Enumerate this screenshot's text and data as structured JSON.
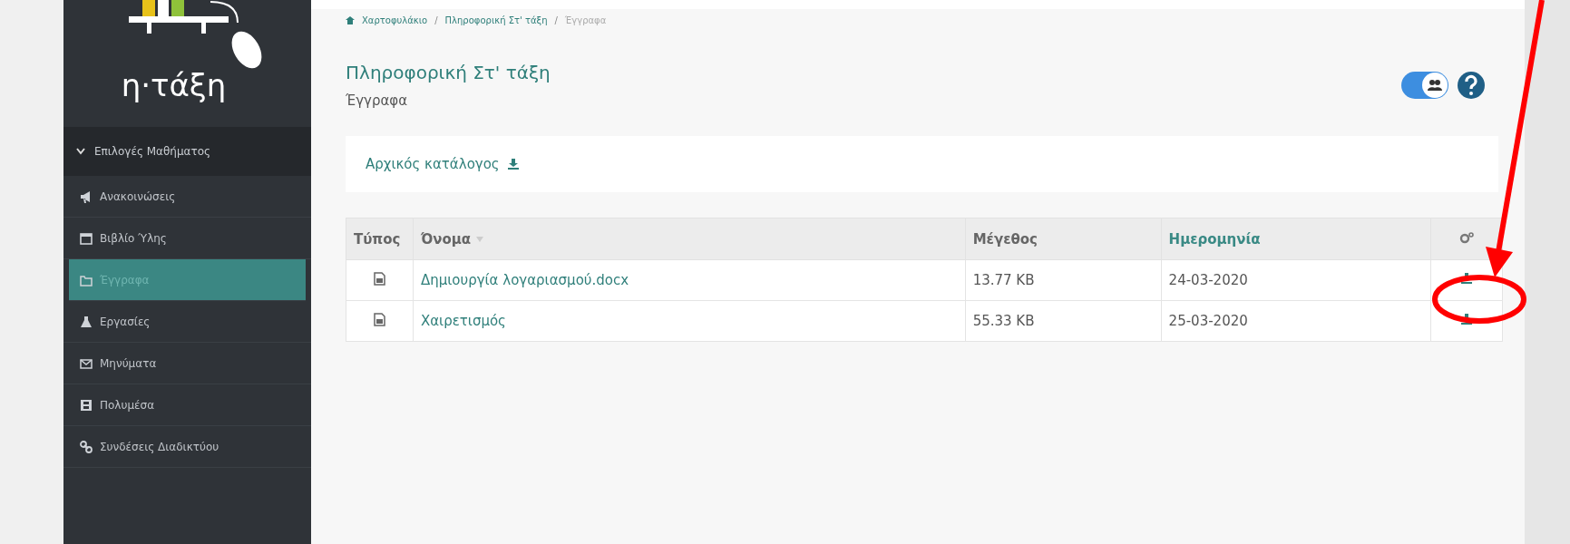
{
  "sidebar": {
    "logo_text": "η·τάξη",
    "section": {
      "label": "Επιλογές Μαθήματος",
      "expanded": true
    },
    "items": [
      {
        "label": "Ανακοινώσεις",
        "selected": false
      },
      {
        "label": "Βιβλίο Ύλης",
        "selected": false
      },
      {
        "label": "Έγγραφα",
        "selected": true
      },
      {
        "label": "Εργασίες",
        "selected": false
      },
      {
        "label": "Μηνύματα",
        "selected": false
      },
      {
        "label": "Πολυμέσα",
        "selected": false
      },
      {
        "label": "Συνδέσεις Διαδικτύου",
        "selected": false
      }
    ]
  },
  "breadcrumb": [
    {
      "label": "Χαρτοφυλάκιο",
      "current": false
    },
    {
      "separator": "/",
      "label": "Πληροφορική Στ' τάξη",
      "current": false
    },
    {
      "separator": "/",
      "label": "Έγγραφα",
      "current": true
    }
  ],
  "header": {
    "title": "Πληροφορική Στ' τάξη",
    "subtitle": "Έγγραφα",
    "toggle": {
      "on": true
    }
  },
  "folder_panel": {
    "label": "Αρχικός κατάλογος"
  },
  "table": {
    "columns": [
      {
        "label": "Τύπος",
        "kind": "text",
        "sortable": false,
        "sorted": false
      },
      {
        "label": "Όνομα",
        "kind": "text",
        "sortable": true,
        "sorted": false
      },
      {
        "label": "Μέγεθος",
        "kind": "text",
        "sortable": false,
        "sorted": false
      },
      {
        "label": "Ημερομηνία",
        "kind": "text",
        "sortable": false,
        "sorted": true
      },
      {
        "kind": "icon"
      }
    ],
    "rows": [
      {
        "name": "Δημιουργία λογαριασμού.docx",
        "size": "13.77 KB",
        "date": "24-03-2020"
      },
      {
        "name": "Χαιρετισμός",
        "size": "55.33 KB",
        "date": "25-03-2020"
      }
    ]
  }
}
